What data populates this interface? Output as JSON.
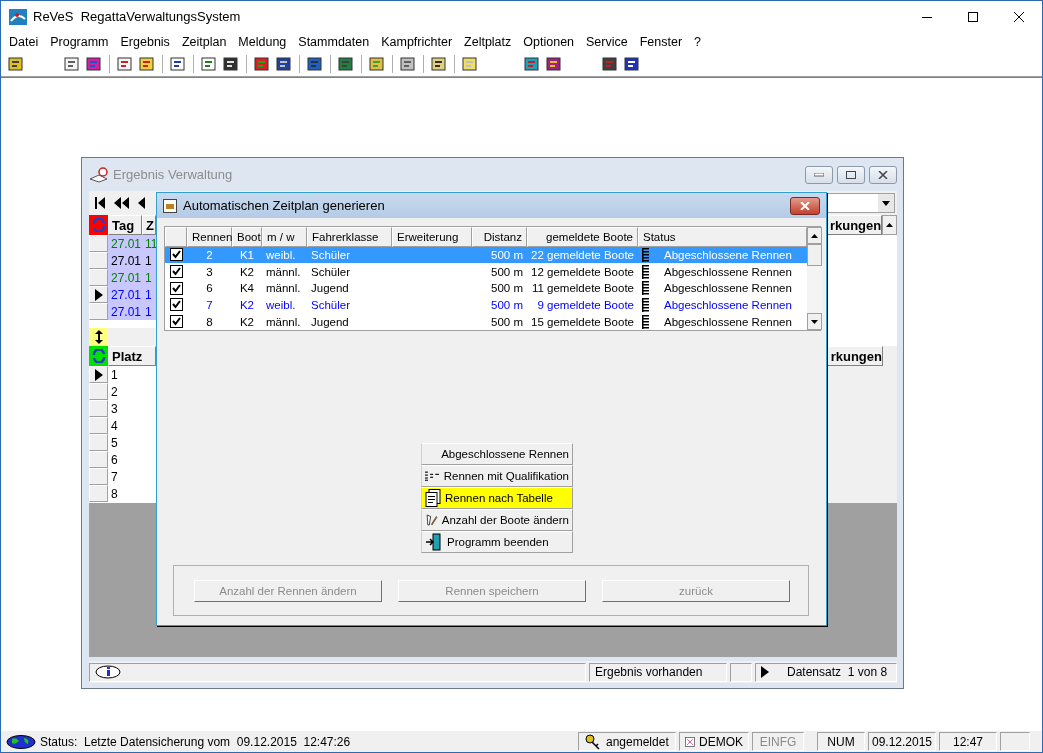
{
  "window": {
    "title": "ReVeS  RegattaVerwaltungsSystem"
  },
  "menu": [
    "Datei",
    "Programm",
    "Ergebnis",
    "Zeitplan",
    "Meldung",
    "Stammdaten",
    "Kampfrichter",
    "Zeltplatz",
    "Optionen",
    "Service",
    "Fenster",
    "?"
  ],
  "child_window": {
    "title": "Ergebnis Verwaltung",
    "top_grid": {
      "columns": [
        "Tag",
        "Z"
      ],
      "rows": [
        {
          "day": "27.01",
          "time": "11",
          "color": "#008000",
          "current": false
        },
        {
          "day": "27.01",
          "time": "1",
          "color": "#000000",
          "current": false
        },
        {
          "day": "27.01",
          "time": "1",
          "color": "#008000",
          "current": false
        },
        {
          "day": "27.01",
          "time": "1",
          "color": "#0000ff",
          "current": true
        },
        {
          "day": "27.01",
          "time": "1",
          "color": "#0000ff",
          "current": false
        }
      ]
    },
    "right_headers": [
      "rkungen",
      "rkungen"
    ],
    "lower_grid": {
      "column": "Platz",
      "rows": [
        {
          "place": "1",
          "current": true
        },
        {
          "place": "2",
          "current": false
        },
        {
          "place": "3",
          "current": false
        },
        {
          "place": "4",
          "current": false
        },
        {
          "place": "5",
          "current": false
        },
        {
          "place": "6",
          "current": false
        },
        {
          "place": "7",
          "current": false
        },
        {
          "place": "8",
          "current": false
        }
      ]
    },
    "status": {
      "message": "Ergebnis vorhanden",
      "record": "Datensatz  1 von 8"
    }
  },
  "dialog": {
    "title": "Automatischen Zeitplan generieren",
    "columns": [
      "Rennen",
      "Boot",
      "m / w",
      "Fahrerklasse",
      "Erweiterung",
      "Distanz",
      "gemeldete Boote",
      "Status"
    ],
    "rows": [
      {
        "checked": true,
        "selected": true,
        "race": "2",
        "boat": "K1",
        "gender": "weibl.",
        "class": "Schüler",
        "distance": "500 m",
        "entries": "22 gemeldete Boote",
        "status": "Abgeschlossene Rennen"
      },
      {
        "checked": true,
        "selected": false,
        "color": "#000000",
        "race": "3",
        "boat": "K2",
        "gender": "männl.",
        "class": "Schüler",
        "distance": "500 m",
        "entries": "12 gemeldete Boote",
        "status": "Abgeschlossene Rennen"
      },
      {
        "checked": true,
        "selected": false,
        "color": "#000000",
        "race": "6",
        "boat": "K4",
        "gender": "männl.",
        "class": "Jugend",
        "distance": "500 m",
        "entries": "11 gemeldete Boote",
        "status": "Abgeschlossene Rennen"
      },
      {
        "checked": true,
        "selected": false,
        "color": "#0000ff",
        "race": "7",
        "boat": "K2",
        "gender": "weibl.",
        "class": "Schüler",
        "distance": "500 m",
        "entries": "9 gemeldete Boote",
        "status": "Abgeschlossene Rennen"
      },
      {
        "checked": true,
        "selected": false,
        "color": "#000000",
        "race": "8",
        "boat": "K2",
        "gender": "männl.",
        "class": "Jugend",
        "distance": "500 m",
        "entries": "15 gemeldete Boote",
        "status": "Abgeschlossene Rennen"
      }
    ],
    "menu_items": [
      {
        "kind": "ladder",
        "label": "Abgeschlossene Rennen",
        "selected": false
      },
      {
        "kind": "qualify",
        "label": "Rennen mit Qualifikation",
        "selected": false
      },
      {
        "kind": "table",
        "label": "Rennen nach Tabelle",
        "selected": true
      },
      {
        "kind": "edit",
        "label": "Anzahl der Boote ändern",
        "selected": false
      },
      {
        "kind": "exit",
        "label": "Programm beenden",
        "selected": false
      }
    ],
    "buttons": [
      {
        "label": "Anzahl der Rennen ändern",
        "disabled": true
      },
      {
        "label": "Rennen speichern",
        "disabled": true
      },
      {
        "label": "zurück",
        "disabled": true
      }
    ]
  },
  "status_bar": {
    "status": "Status:  Letzte Datensicherung vom  09.12.2015  12:47:26",
    "login": "angemeldet",
    "user": "DEMOK",
    "insert": {
      "label": "EINFG",
      "disabled": true
    },
    "num": "NUM",
    "date": "09.12.2015",
    "time": "12:47"
  }
}
